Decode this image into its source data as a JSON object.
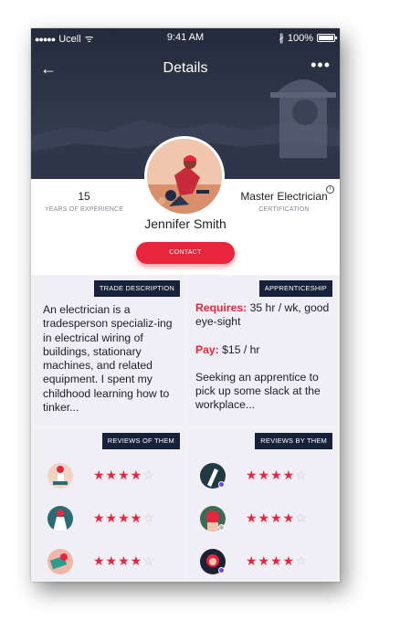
{
  "status_bar": {
    "signal": "●●●●●",
    "carrier": "Ucell",
    "wifi": "ᯤ",
    "time": "9:41 AM",
    "bluetooth": "∦",
    "battery": "100%"
  },
  "nav": {
    "back_icon": "←",
    "title": "Details",
    "more_icon": "•••"
  },
  "profile": {
    "name": "Jennifer Smith",
    "experience_value": "15",
    "experience_label": "YEARS OF EXPERIENCE",
    "certification_value": "Master Electrician",
    "certification_label": "CERTIFICATION",
    "info_icon": "i",
    "contact_label": "CONTACT"
  },
  "trade": {
    "tag": "TRADE DESCRIPTION",
    "text": "An electrician is a tradesperson specializ-ing in electrical wiring of buildings, stationary machines, and related equipment. I spent my childhood learning how to tinker..."
  },
  "apprenticeship": {
    "tag": "APPRENTICESHIP",
    "requires_label": "Requires:",
    "requires_value": " 35 hr / wk, good eye-sight",
    "pay_label": "Pay:",
    "pay_value": " $15 / hr",
    "note": "Seeking an apprentice to pick up some slack at the workplace..."
  },
  "reviews_of_them": {
    "tag": "REVIEWS OF THEM",
    "items": [
      {
        "rating": 4,
        "stars_on": "★★★★",
        "stars_off": "☆"
      },
      {
        "rating": 4,
        "stars_on": "★★★★",
        "stars_off": "☆"
      },
      {
        "rating": 4,
        "stars_on": "★★★★",
        "stars_off": "☆"
      }
    ]
  },
  "reviews_by_them": {
    "tag": "REVIEWS BY THEM",
    "items": [
      {
        "rating": 4,
        "stars_on": "★★★★",
        "stars_off": "☆",
        "status_color": "#7b3fe4"
      },
      {
        "rating": 4,
        "stars_on": "★★★★",
        "stars_off": "☆",
        "status_color": "#b8b8c0"
      },
      {
        "rating": 4,
        "stars_on": "★★★★",
        "stars_off": "☆",
        "status_color": "#7b3fe4"
      }
    ]
  },
  "colors": {
    "accent": "#e8253d",
    "tag_bg": "#17213a",
    "header_bg": "#2d3548",
    "card_bg": "#f1eff6"
  }
}
